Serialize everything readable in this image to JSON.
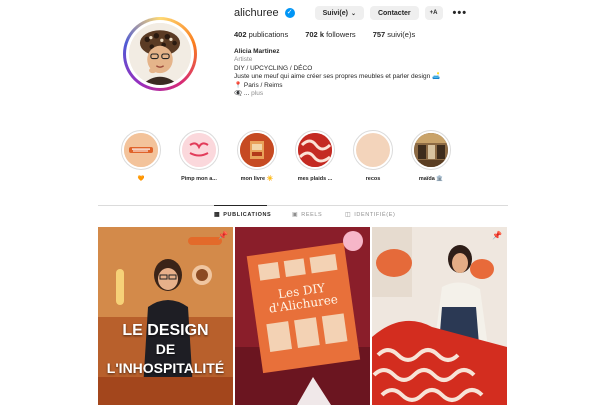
{
  "profile": {
    "username": "alichuree",
    "follow_label": "Suivi(e)",
    "message_label": "Contacter",
    "suggest_icon": "+A",
    "more_icon": "•••",
    "stats": {
      "posts_count": "402",
      "posts_label": "publications",
      "followers_count": "702 k",
      "followers_label": "followers",
      "following_count": "757",
      "following_label": "suivi(e)s"
    },
    "bio": {
      "name": "Alicia Martinez",
      "category": "Artiste",
      "line1": "DIY / UPCYCLING / DÉCO",
      "line2": "Juste une meuf qui aime créer ses propres meubles et parler design 🛋️",
      "location": "📍 Paris / Reims",
      "more_prefix": "👁‍🗨 ...",
      "more_label": "plus"
    }
  },
  "highlights": [
    {
      "label": "🧡"
    },
    {
      "label": "Pimp mon a..."
    },
    {
      "label": "mon livre ☀️"
    },
    {
      "label": "mes plaids ..."
    },
    {
      "label": "recos"
    },
    {
      "label": "maïda 🏛️"
    }
  ],
  "tabs": [
    {
      "label": "PUBLICATIONS"
    },
    {
      "label": "REELS"
    },
    {
      "label": "IDENTIFIÉ(E)"
    }
  ],
  "posts": [
    {
      "overlay_line1": "LE DESIGN",
      "overlay_line2": "DE L'INHOSPITALITÉ"
    },
    {
      "book_title_line1": "Les DIY",
      "book_title_line2": "d'Alichuree"
    },
    {}
  ],
  "colors": {
    "verified": "#0095f6",
    "button_bg": "#efefef",
    "text": "#262626",
    "muted": "#8e8e8e"
  }
}
